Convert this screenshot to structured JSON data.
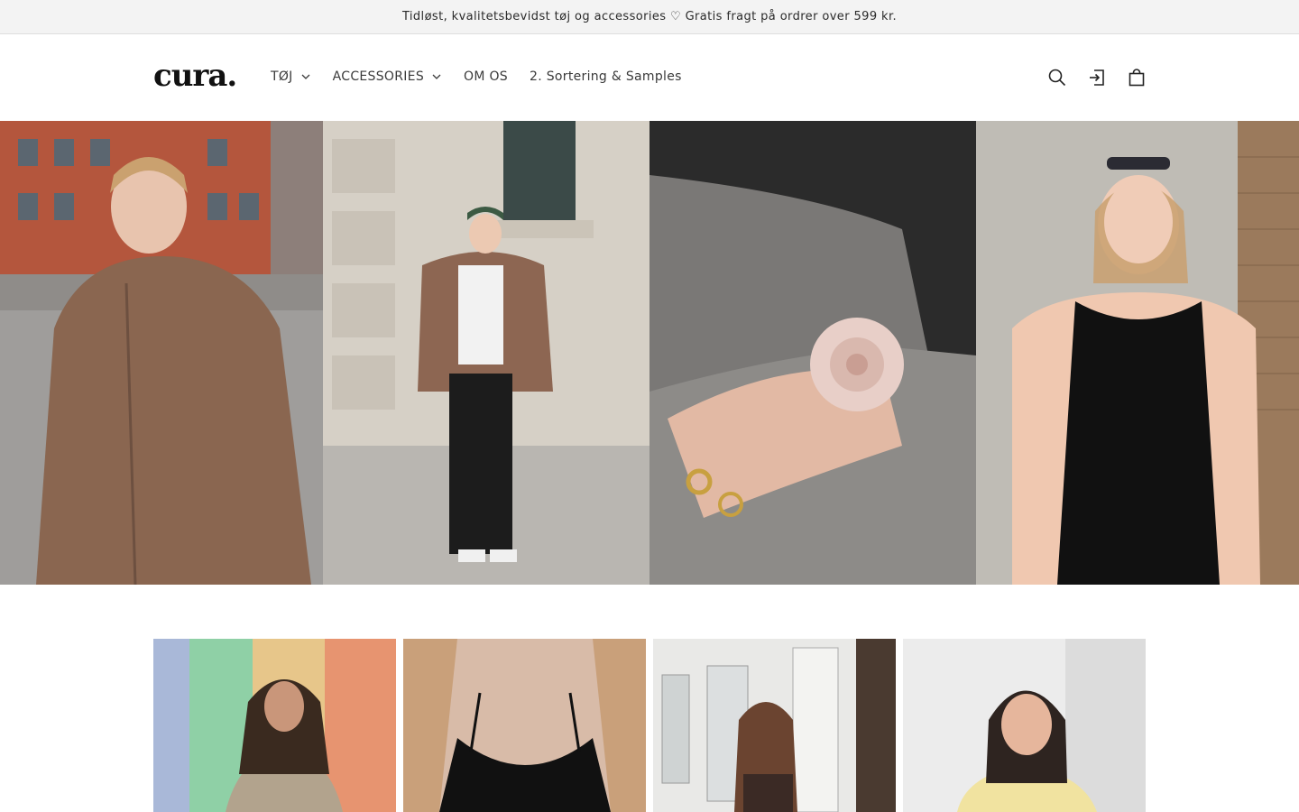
{
  "announcement": {
    "text": "Tidløst, kvalitetsbevidst tøj og accessories ♡ Gratis fragt på ordrer over 599 kr."
  },
  "header": {
    "logo": "cura.",
    "nav": [
      {
        "label": "TØJ",
        "has_dropdown": true
      },
      {
        "label": "ACCESSORIES",
        "has_dropdown": true
      },
      {
        "label": "OM OS",
        "has_dropdown": false
      },
      {
        "label": "2. Sortering & Samples",
        "has_dropdown": false
      }
    ],
    "icons": [
      "search-icon",
      "account-icon",
      "cart-icon"
    ]
  },
  "hero": {
    "images": [
      {
        "name": "hero-image-fleece-jacket-street",
        "description_icon": "photo"
      },
      {
        "name": "hero-image-fleece-jacket-full-body",
        "description_icon": "photo"
      },
      {
        "name": "hero-image-silk-scrunchie-rings",
        "description_icon": "photo"
      },
      {
        "name": "hero-image-black-tank-top",
        "description_icon": "photo"
      }
    ]
  },
  "products": {
    "cards": [
      {
        "name": "product-card-linen-blouse"
      },
      {
        "name": "product-card-black-camisole"
      },
      {
        "name": "product-card-brown-top-back"
      },
      {
        "name": "product-card-yellow-sweater"
      }
    ]
  },
  "colors": {
    "announcement_bg": "#f3f3f3",
    "text": "#121212",
    "border": "#dedede"
  }
}
